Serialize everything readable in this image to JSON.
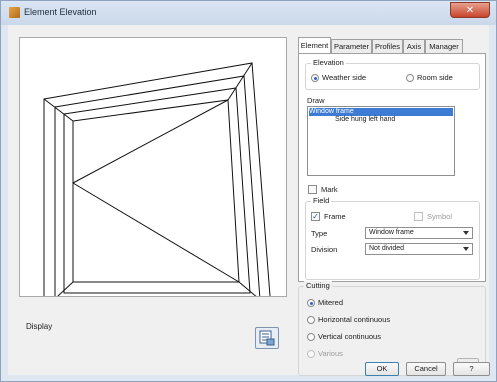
{
  "window": {
    "title": "Element Elevation",
    "close_glyph": "✕"
  },
  "left": {
    "display_label": "Display",
    "display_button_icon": "preview-settings-icon"
  },
  "tabs": [
    "Element",
    "Parameter",
    "Profiles",
    "Axis",
    "Manager"
  ],
  "active_tab": "Element",
  "elevation": {
    "label": "Elevation",
    "options": [
      {
        "label": "Weather side",
        "selected": true
      },
      {
        "label": "Room side",
        "selected": false
      }
    ]
  },
  "draw": {
    "label": "Draw",
    "items": [
      "Window frame",
      "Side hung left hand"
    ],
    "selected_index": 0
  },
  "mark": {
    "label": "Mark",
    "checked": false
  },
  "field": {
    "label": "Field",
    "frame": {
      "label": "Frame",
      "checked": true
    },
    "symbol": {
      "label": "Symbol",
      "checked": false,
      "disabled": true
    },
    "type": {
      "label": "Type",
      "value": "Window frame"
    },
    "division": {
      "label": "Division",
      "value": "Not divided"
    }
  },
  "cutting": {
    "label": "Cutting",
    "options": [
      {
        "label": "Mitered",
        "selected": true,
        "disabled": false
      },
      {
        "label": "Horizontal continuous",
        "selected": false,
        "disabled": false
      },
      {
        "label": "Vertical continuous",
        "selected": false,
        "disabled": false
      },
      {
        "label": "Various",
        "selected": false,
        "disabled": true
      }
    ],
    "more_button": "..."
  },
  "buttons": {
    "ok": "OK",
    "cancel": "Cancel",
    "help": "?"
  },
  "colors": {
    "selection": "#3d7bd4",
    "accent": "#2a62c9"
  }
}
